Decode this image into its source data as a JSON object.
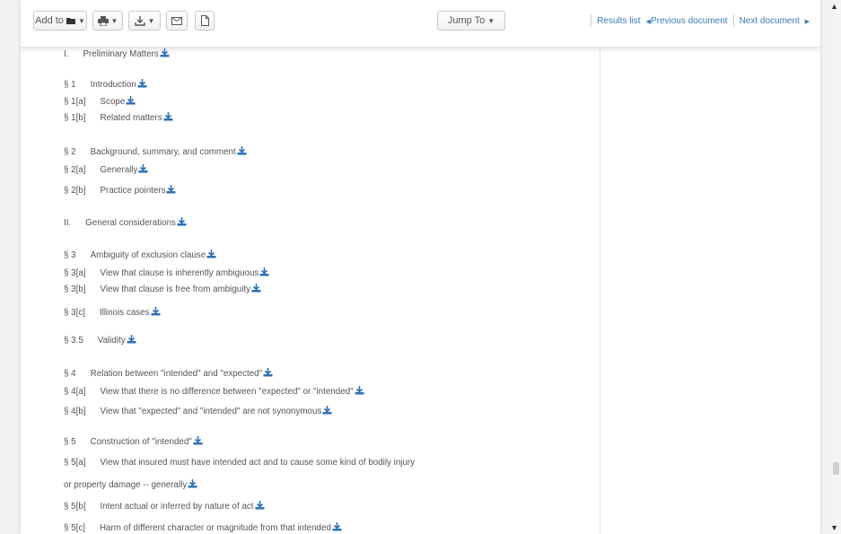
{
  "toolbar": {
    "add_to": "Add to",
    "jump_to": "Jump To",
    "results_list": "Results list",
    "previous_document": "Previous document",
    "next_document": "Next document"
  },
  "toc": [
    {
      "num": "I.",
      "title": "Preliminary Matters"
    },
    {
      "num": "§ 1",
      "title": "Introduction"
    },
    {
      "num": "§ 1[a]",
      "title": "Scope"
    },
    {
      "num": "§ 1[b]",
      "title": "Related matters"
    },
    {
      "num": "§ 2",
      "title": "Background, summary, and comment"
    },
    {
      "num": "§ 2[a]",
      "title": "Generally"
    },
    {
      "num": "§ 2[b]",
      "title": "Practice pointers"
    },
    {
      "num": "II.",
      "title": "General considerations"
    },
    {
      "num": "§ 3",
      "title": "Ambiguity of exclusion clause"
    },
    {
      "num": "§ 3[a]",
      "title": "View that clause is inherently ambiguous"
    },
    {
      "num": "§ 3[b]",
      "title": "View that clause is free from ambiguity"
    },
    {
      "num": "§ 3[c]",
      "title": "Illinois cases"
    },
    {
      "num": "§ 3.5",
      "title": "Validity"
    },
    {
      "num": "§ 4",
      "title": "Relation between \"intended\" and \"expected\""
    },
    {
      "num": "§ 4[a]",
      "title": "View that there is no difference between \"expected\" or \"intended\""
    },
    {
      "num": "§ 4[b]",
      "title": "View that \"expected\" and \"intended\" are not synonymous"
    },
    {
      "num": "§ 5",
      "title": "Construction of \"intended\""
    },
    {
      "num": "§ 5[a]",
      "title": "View that insured must have intended act and to cause some kind of bodily injury"
    },
    {
      "num": "",
      "title": "or property damage -- generally"
    },
    {
      "num": "§ 5[b]",
      "title": "Intent actual or inferred by nature of act"
    },
    {
      "num": "§ 5[c]",
      "title": "Harm of different character or magnitude from that intended"
    }
  ]
}
